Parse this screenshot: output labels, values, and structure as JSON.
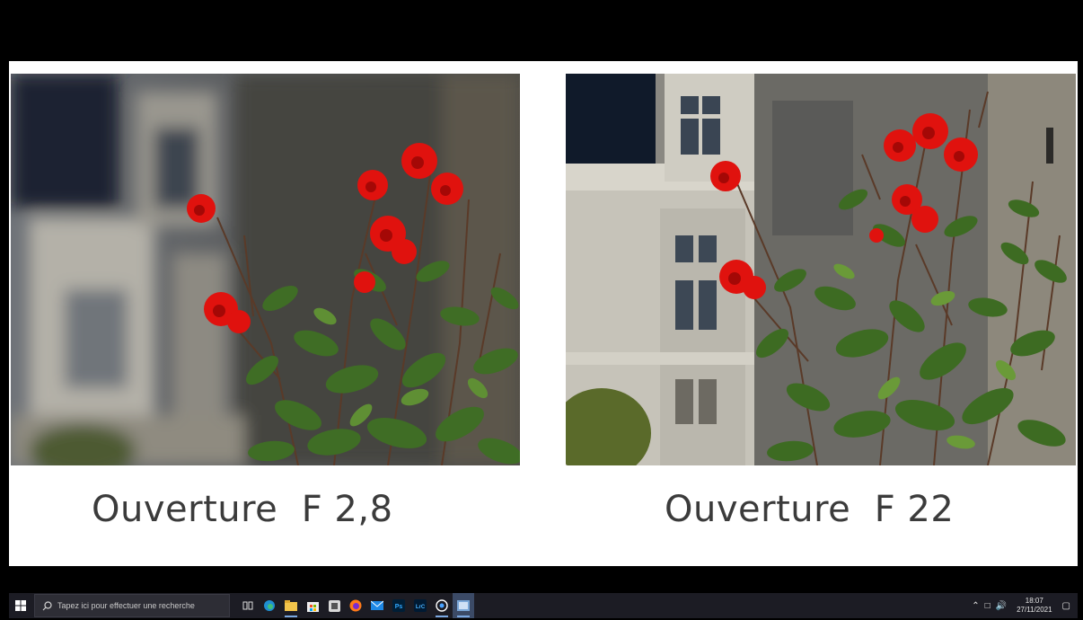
{
  "slide": {
    "left_caption": "Ouverture  F 2,8",
    "right_caption": "Ouverture  F 22"
  },
  "taskbar": {
    "search_placeholder": "Tapez ici pour effectuer une recherche",
    "icons": [
      "task-view-icon",
      "edge-icon",
      "file-explorer-icon",
      "store-icon",
      "app-icon",
      "firefox-icon",
      "mail-icon",
      "photoshop-icon",
      "lightroom-icon",
      "security-icon",
      "active-app-icon"
    ],
    "photoshop_label": "Ps",
    "lightroom_label": "LrC",
    "time": "18:07",
    "date": "27/11/2021"
  },
  "colors": {
    "rose": "#e0120e",
    "leaf": "#3f6d25",
    "taskbar": "#1c1c24"
  }
}
